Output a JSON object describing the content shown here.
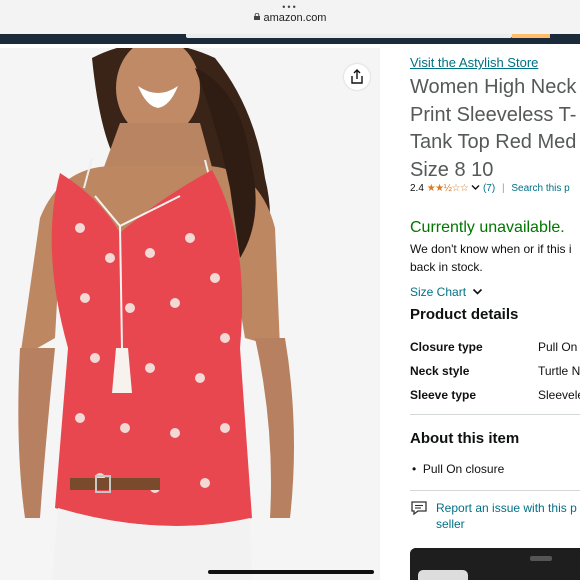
{
  "browser": {
    "url": "amazon.com",
    "menu_dots": "•••"
  },
  "product": {
    "store_link": "Visit the Astylish Store",
    "title": "Women High Neck\nPrint Sleeveless T-\nTank Top Red Med\nSize 8 10",
    "rating": "2.4",
    "rating_stars": 2.4,
    "review_count": "(7)",
    "search_link": "Search this p",
    "availability": "Currently unavailable.",
    "availability_note": "We don't know when or if this i\nback in stock.",
    "size_chart": "Size Chart"
  },
  "details": {
    "heading": "Product details",
    "specs": [
      {
        "key": "Closure type",
        "value": "Pull On"
      },
      {
        "key": "Neck style",
        "value": "Turtle N"
      },
      {
        "key": "Sleeve type",
        "value": "Sleevele"
      }
    ]
  },
  "about": {
    "heading": "About this item",
    "bullets": [
      "Pull On closure"
    ]
  },
  "report": {
    "text": "Report an issue with this p\nseller"
  },
  "colors": {
    "link": "#007185",
    "available": "#007600",
    "star": "#de7921",
    "shirt": "#e8474f",
    "nav_dark": "#1b2b3a",
    "nav_accent": "#febd69"
  }
}
